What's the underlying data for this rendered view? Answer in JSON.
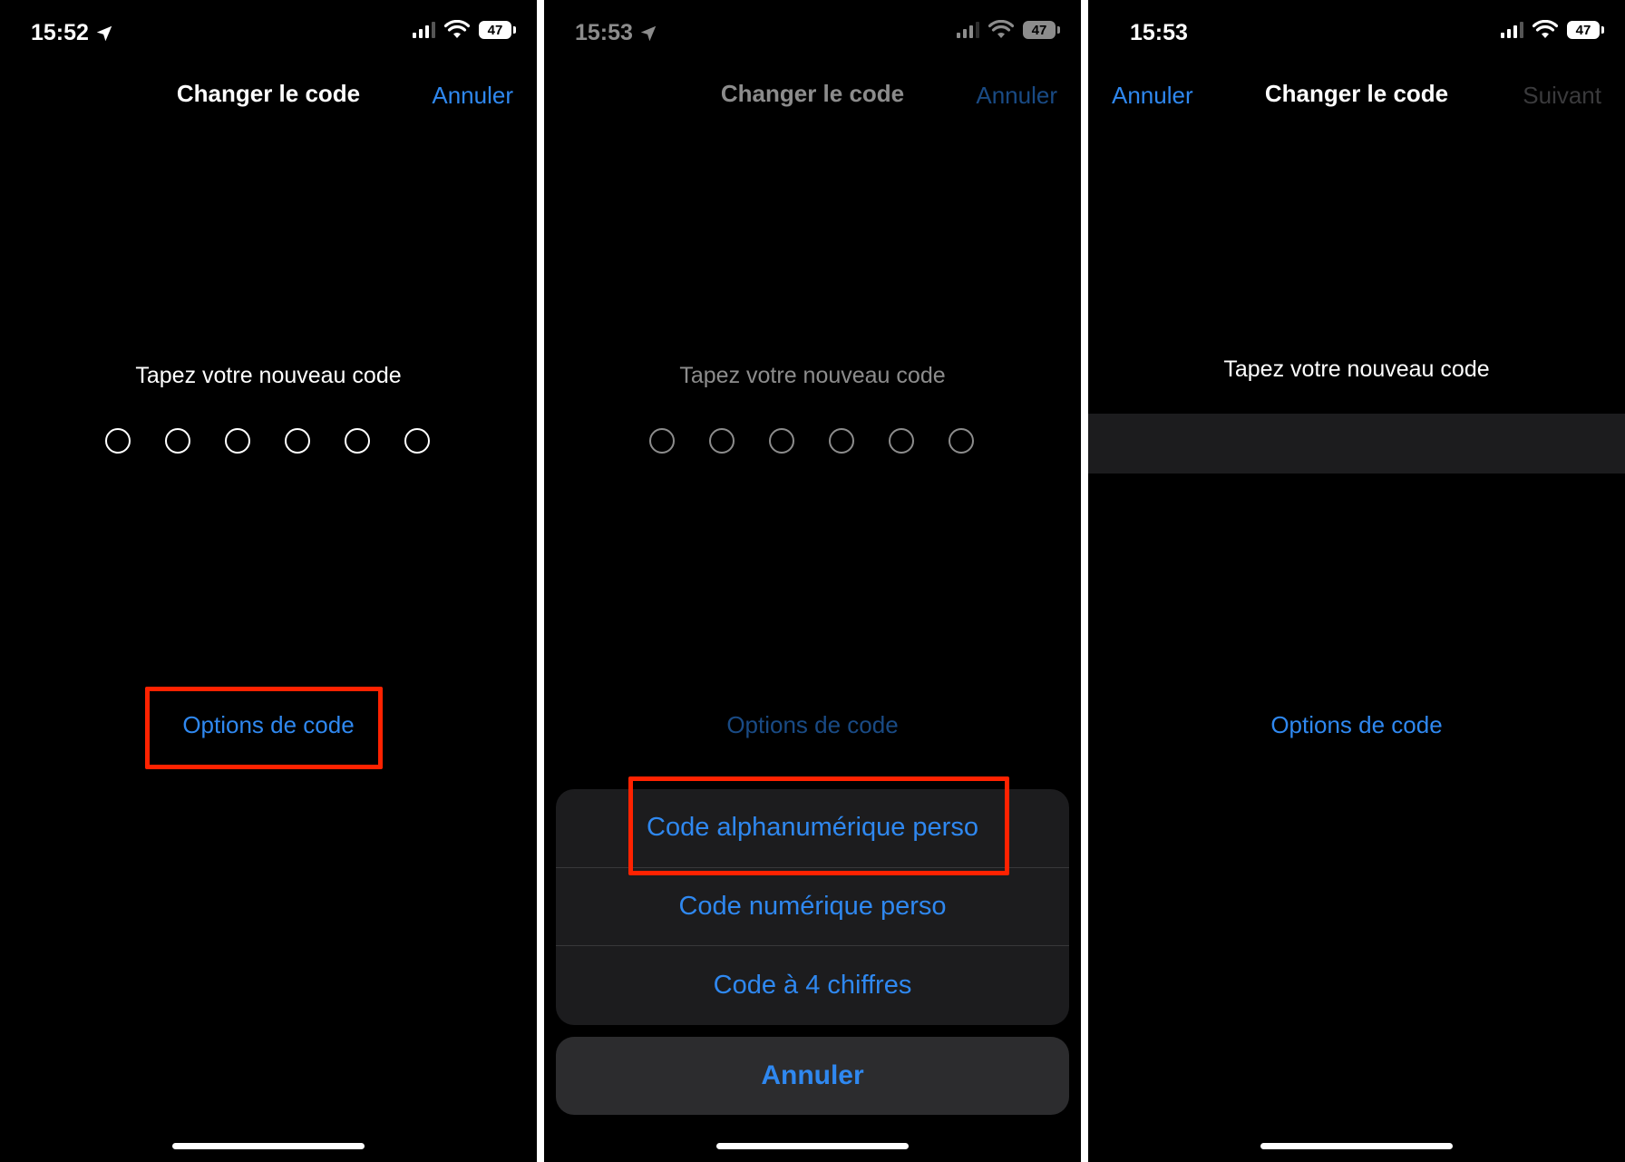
{
  "panels": [
    {
      "status": {
        "time": "15:52",
        "battery": "47"
      },
      "nav": {
        "title": "Changer le code",
        "cancel": "Annuler"
      },
      "prompt": "Tapez votre nouveau code",
      "options_link": "Options de code"
    },
    {
      "status": {
        "time": "15:53",
        "battery": "47"
      },
      "nav": {
        "title": "Changer le code",
        "cancel": "Annuler"
      },
      "prompt": "Tapez votre nouveau code",
      "options_link": "Options de code",
      "sheet": {
        "items": [
          "Code alphanumérique perso",
          "Code numérique perso",
          "Code à 4 chiffres"
        ],
        "cancel": "Annuler"
      }
    },
    {
      "status": {
        "time": "15:53",
        "battery": "47"
      },
      "nav": {
        "title": "Changer le code",
        "cancel": "Annuler",
        "next": "Suivant"
      },
      "prompt": "Tapez votre nouveau code",
      "options_link": "Options de code"
    }
  ],
  "colors": {
    "accent": "#2f88f0",
    "highlight": "#ff2200",
    "background": "#000000"
  }
}
